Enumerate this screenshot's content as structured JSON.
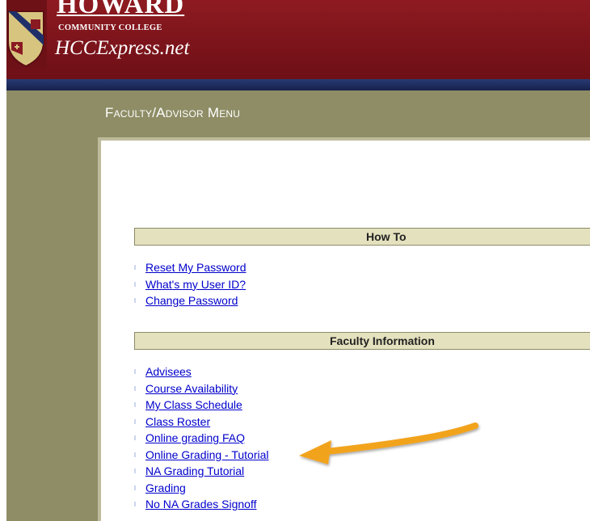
{
  "header": {
    "title": "HOWARD",
    "subtitle": "COMMUNITY COLLEGE",
    "site": "HCCExpress.net",
    "colors": {
      "maroon": "#8e1a21",
      "navy": "#1e2d5e"
    }
  },
  "page": {
    "heading": "Faculty/Advisor Menu",
    "colors": {
      "olive": "#8e8d66",
      "bar": "#e4e1be",
      "link": "#0000cc"
    }
  },
  "sections": [
    {
      "title": "How To",
      "links": [
        "Reset My Password",
        "What's my User ID?",
        "Change Password"
      ]
    },
    {
      "title": "Faculty Information",
      "links": [
        "Advisees",
        "Course Availability",
        "My Class Schedule",
        "Class Roster",
        "Online grading FAQ",
        "Online Grading - Tutorial",
        "NA Grading Tutorial",
        "Grading",
        "No NA Grades Signoff"
      ]
    }
  ],
  "annotation": {
    "icon": "arrow-left-icon",
    "color": "#f2a31f"
  }
}
